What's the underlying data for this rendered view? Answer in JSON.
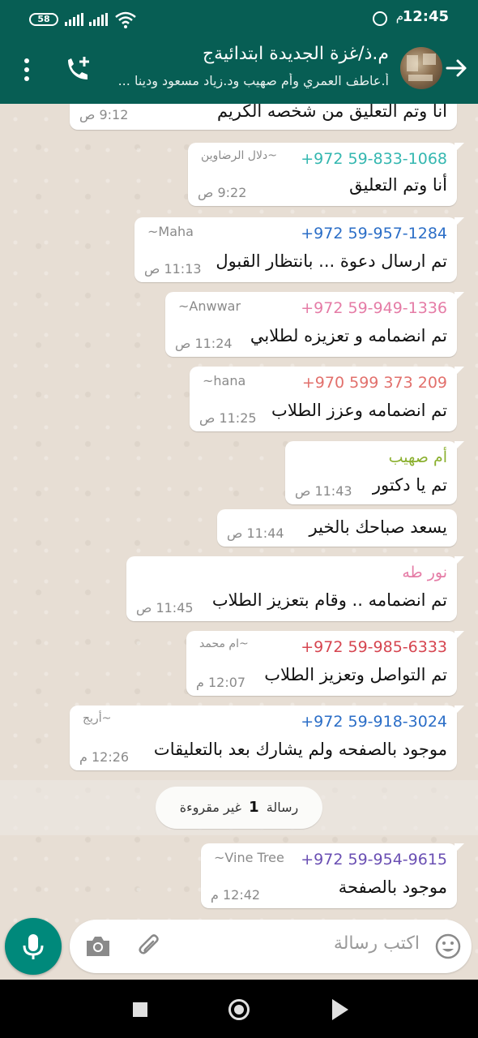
{
  "status_bar": {
    "time": "12:45",
    "ampm": "م",
    "battery": "58"
  },
  "header": {
    "title": "م.ذ/غزة الجديدة ابتدائيةج",
    "subtitle": "أ.عاطف العمري وأم صهيب ود.زياد مسعود ودينا ..."
  },
  "messages": [
    {
      "sender": "",
      "pushname": "",
      "text": "أنا وتم التعليق من شخصه الكريم",
      "time": "9:12 ص"
    },
    {
      "sender": "+972 59-833-1068",
      "sender_color": "#34b7b0",
      "pushname": "~دلال الرضاوين",
      "text": "أنا وتم التعليق",
      "time": "9:22 ص"
    },
    {
      "sender": "+972 59-957-1284",
      "sender_color": "#2b6ec7",
      "pushname": "~Maha",
      "text": "تم ارسال دعوة ... بانتظار القبول",
      "time": "11:13 ص"
    },
    {
      "sender": "+972 59-949-1336",
      "sender_color": "#e57ca6",
      "pushname": "~Anwwar",
      "text": "تم انضمامه و تعزيزه لطلابي",
      "time": "11:24 ص"
    },
    {
      "sender": "+970 599 373 209",
      "sender_color": "#e2706c",
      "pushname": "~hana",
      "text": "تم انضمامه وعزز الطلاب",
      "time": "11:25 ص"
    },
    {
      "sender": "أم صهيب",
      "sender_color": "#8bb02f",
      "pushname": "",
      "text": "تم يا دكتور",
      "time": "11:43 ص"
    },
    {
      "sender": "",
      "pushname": "",
      "text": "يسعد صباحك بالخير",
      "time": "11:44 ص"
    },
    {
      "sender": "نور طه",
      "sender_color": "#e57ca6",
      "pushname": "",
      "text": "تم انضمامه .. وقام بتعزيز الطلاب",
      "time": "11:45 ص"
    },
    {
      "sender": "+972 59-985-6333",
      "sender_color": "#d64550",
      "pushname": "~ام محمد",
      "text": "تم التواصل وتعزيز الطلاب",
      "time": "12:07 م"
    },
    {
      "sender": "+972 59-918-3024",
      "sender_color": "#2b6ec7",
      "pushname": "~أريج",
      "text": "موجود بالصفحه ولم يشارك بعد بالتعليقات",
      "time": "12:26 م"
    },
    {
      "sender": "+972 59-954-9615",
      "sender_color": "#6a4fb3",
      "pushname": "~Vine Tree",
      "text": "موجود بالصفحة",
      "time": "12:42 م"
    }
  ],
  "unread": {
    "prefix": "رسالة",
    "count": "1",
    "suffix": "غير مقروءة"
  },
  "composer": {
    "placeholder": "اكتب رسالة"
  },
  "icons": {
    "back": "arrow-right-icon",
    "add_call": "add-call-icon",
    "menu": "more-vertical-icon",
    "emoji": "emoji-icon",
    "attach": "paperclip-icon",
    "camera": "camera-icon",
    "mic": "microphone-icon"
  },
  "colors": {
    "primary": "#075e54",
    "accent": "#00897b",
    "chat_bg": "#e7ded4"
  }
}
